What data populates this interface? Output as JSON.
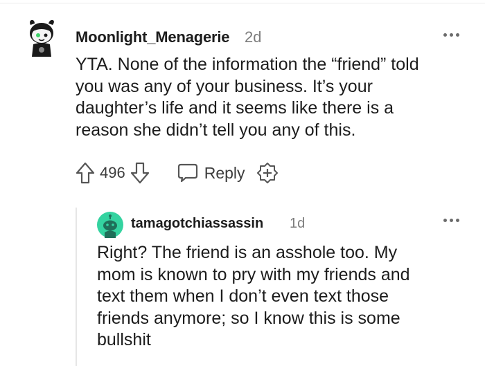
{
  "comment": {
    "author": "Moonlight_Menagerie",
    "age": "2d",
    "lines": [
      "YTA. None of the information the “friend” told",
      "you was any of your business. It’s your",
      "daughter’s life and it seems like there is a",
      "reason she didn’t tell you any of this."
    ],
    "score": "496",
    "reply_label": "Reply"
  },
  "reply": {
    "author": "tamagotchiassassin",
    "age": "1d",
    "lines": [
      "Right? The friend is an asshole too. My",
      "mom is known to pry with my friends and",
      "text them when I don’t even text those",
      "friends anymore; so I know this is some",
      "bullshit"
    ]
  },
  "icons": {
    "upvote": "upvote-arrow-icon",
    "downvote": "downvote-arrow-icon",
    "reply": "speech-bubble-icon",
    "award": "add-award-icon",
    "more": "more-options-icon"
  },
  "colors": {
    "reply_avatar_bg": "#34d3a0",
    "muted_text": "#7c7c7c"
  }
}
